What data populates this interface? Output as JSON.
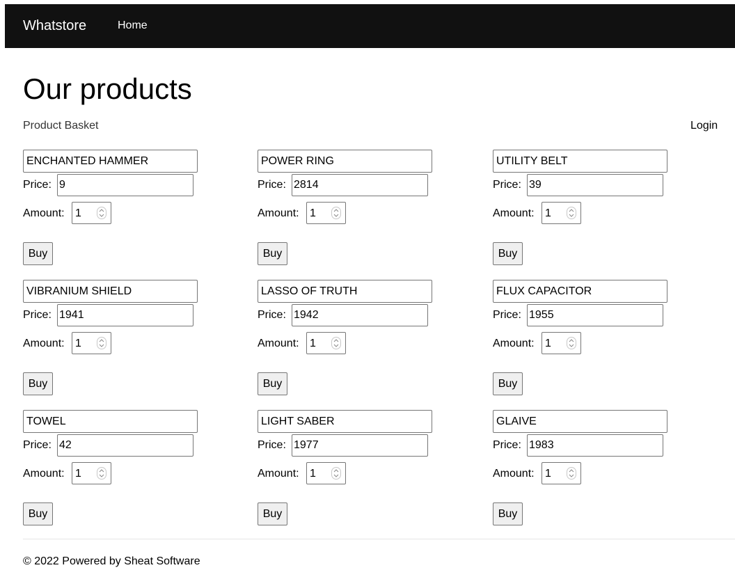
{
  "navbar": {
    "brand": "Whatstore",
    "links": [
      "Home"
    ]
  },
  "page": {
    "title": "Our products",
    "basket_link": "Product Basket",
    "login_link": "Login"
  },
  "labels": {
    "price": "Price:",
    "amount": "Amount:",
    "buy": "Buy"
  },
  "products": [
    {
      "name": "ENCHANTED HAMMER",
      "price": "9",
      "amount": "1"
    },
    {
      "name": "POWER RING",
      "price": "2814",
      "amount": "1"
    },
    {
      "name": "UTILITY BELT",
      "price": "39",
      "amount": "1"
    },
    {
      "name": "VIBRANIUM SHIELD",
      "price": "1941",
      "amount": "1"
    },
    {
      "name": "LASSO OF TRUTH",
      "price": "1942",
      "amount": "1"
    },
    {
      "name": "FLUX CAPACITOR",
      "price": "1955",
      "amount": "1"
    },
    {
      "name": "TOWEL",
      "price": "42",
      "amount": "1"
    },
    {
      "name": "LIGHT SABER",
      "price": "1977",
      "amount": "1"
    },
    {
      "name": "GLAIVE",
      "price": "1983",
      "amount": "1"
    }
  ],
  "footer": {
    "text": "© 2022 Powered by Sheat Software"
  },
  "colors": {
    "navbar_bg": "#111111",
    "navbar_text": "#ffffff",
    "button_bg": "#efefef"
  }
}
